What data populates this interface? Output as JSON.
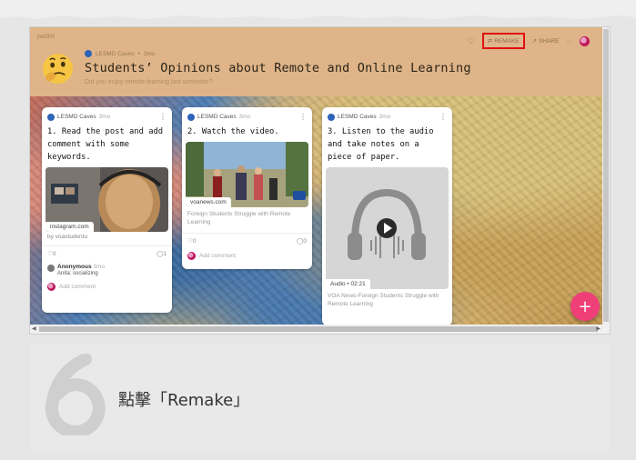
{
  "padlet": {
    "logo": "padlet",
    "author": "LESMD Caves",
    "author_time": "3mo",
    "title": "Students’ Opinions about Remote and Online Learning",
    "subtitle": "Did you enjoy remote learning last semester?",
    "toolbar": {
      "remake": "REMAKE",
      "share": "SHARE",
      "more": "···"
    }
  },
  "cards": [
    {
      "author": "LESMD Caves",
      "time": "3mo",
      "title": "1. Read the post and add comment with some keywords.",
      "media_label": "instagram.com",
      "by": "by voastudentu",
      "likes": "0",
      "comments": "1",
      "comment_author": "Anonymous",
      "comment_time": "3mo",
      "comment_text": "Anita: socializing",
      "add_comment": "Add comment"
    },
    {
      "author": "LESMD Caves",
      "time": "3mo",
      "title": "2. Watch the video.",
      "media_label": "voanews.com",
      "caption": "Foreign Students Struggle with Remote Learning",
      "likes": "0",
      "comments": "0",
      "add_comment": "Add comment"
    },
    {
      "author": "LESMD Caves",
      "time": "3mo",
      "title": "3. Listen to the audio and take notes on a piece of paper.",
      "media_label": "Audio • 02:21",
      "caption": "VOA News-Foreign Students Struggle with Remote Learning"
    }
  ],
  "fab": "+",
  "step": {
    "number": "6",
    "text": "點擊「Remake」"
  },
  "colors": {
    "header": "#deb488",
    "highlight": "#e01010",
    "fab": "#ef3f78"
  }
}
